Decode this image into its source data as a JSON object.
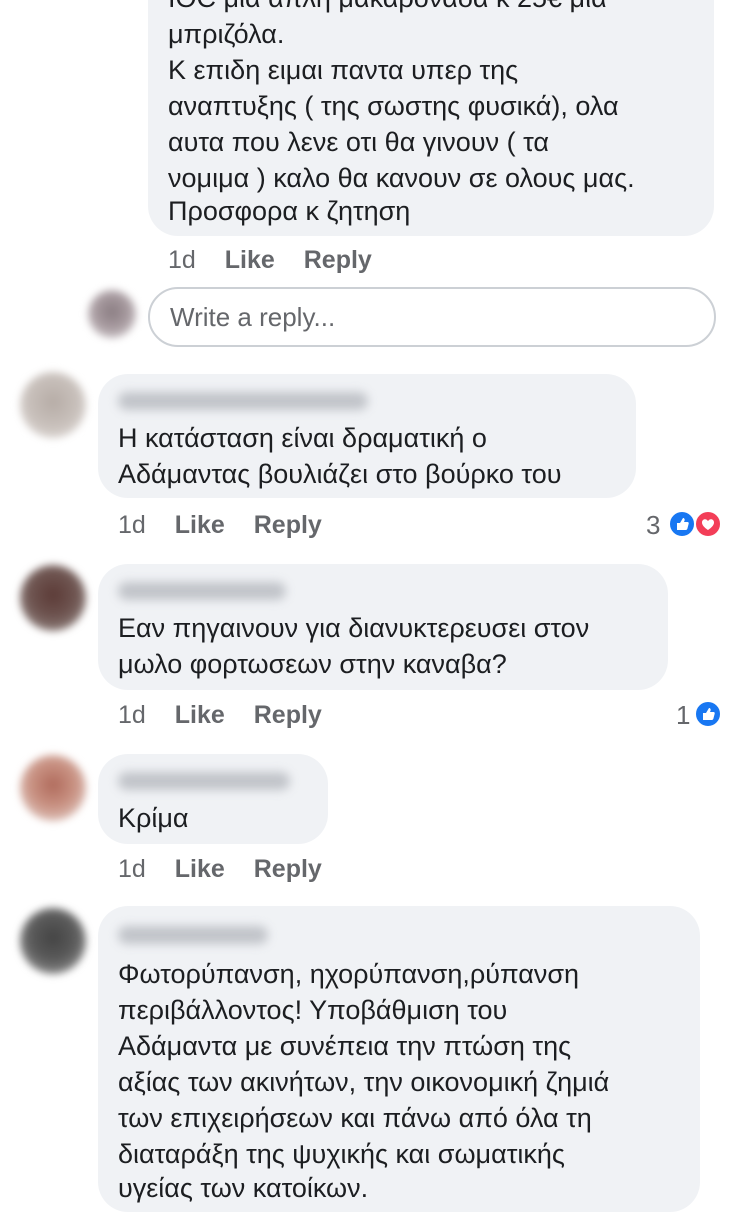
{
  "comments": [
    {
      "text_lines": [
        "μπριζόλα.",
        "Κ επιδη ειμαι παντα υπερ της",
        "αναπτυξης ( της σωστης φυσικά), ολα",
        "αυτα που λενε οτι θα γινουν ( τα",
        "νομιμα ) καλο θα κανουν σε ολους μας.",
        "Προσφορα κ ζητηση"
      ],
      "time": "1d",
      "like": "Like",
      "reply": "Reply"
    },
    {
      "text_lines": [
        "Η κατάσταση είναι δραματική ο",
        "Αδάμαντας βουλιάζει στο βούρκο του"
      ],
      "time": "1d",
      "like": "Like",
      "reply": "Reply",
      "reactions_count": "3"
    },
    {
      "text_lines": [
        "Εαν πηγαινουν για διανυκτερευσει στον",
        "μωλο φορτωσεων στην καναβα?"
      ],
      "time": "1d",
      "like": "Like",
      "reply": "Reply",
      "reactions_count": "1"
    },
    {
      "text_lines": [
        "Κρίμα"
      ],
      "time": "1d",
      "like": "Like",
      "reply": "Reply"
    },
    {
      "text_lines": [
        "Φωτορύπανση,  ηχορύπανση,ρύπανση",
        "περιβάλλοντος! Υποβάθμιση του",
        "Αδάμαντα με συνέπεια την πτώση της",
        "αξίας των ακινήτων, την οικονομική ζημιά",
        "των επιχειρήσεων και πάνω από όλα τη",
        "διαταράξη της ψυχικής και σωματικής",
        "υγείας των κατοίκων."
      ]
    }
  ],
  "reply_box": {
    "placeholder": "Write a reply..."
  },
  "colors": {
    "bubble": "#f0f2f5",
    "meta": "#65676b",
    "like_blue": "#1877f2",
    "love_red": "#f33e58"
  },
  "icons": {
    "like": "like-reaction-icon",
    "love": "love-reaction-icon"
  }
}
